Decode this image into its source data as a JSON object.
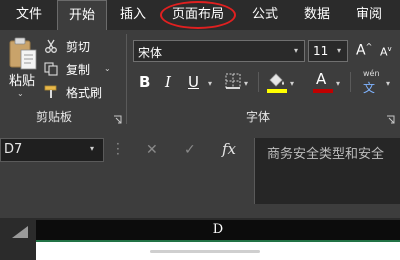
{
  "tabs": [
    {
      "label": "文件",
      "active": false
    },
    {
      "label": "开始",
      "active": true
    },
    {
      "label": "插入",
      "active": false
    },
    {
      "label": "页面布局",
      "active": false,
      "highlighted": true
    },
    {
      "label": "公式",
      "active": false
    },
    {
      "label": "数据",
      "active": false
    },
    {
      "label": "审阅",
      "active": false
    }
  ],
  "clipboard": {
    "paste_label": "粘贴",
    "cut_label": "剪切",
    "copy_label": "复制",
    "format_painter_label": "格式刷",
    "group_label": "剪贴板"
  },
  "font": {
    "font_name": "宋体",
    "font_size": "11",
    "grow_glyph": "A",
    "shrink_glyph": "A",
    "bold": "B",
    "italic": "I",
    "underline": "U",
    "font_color_glyph": "A",
    "phonetic_top": "wén",
    "phonetic_bottom": "文",
    "group_label": "字体"
  },
  "formula_bar": {
    "name_box": "D7",
    "cancel_glyph": "✕",
    "enter_glyph": "✓",
    "fx_label": "fx",
    "content": "商务安全类型和安全"
  },
  "grid": {
    "column_label": "D"
  },
  "colors": {
    "highlight_oval": "#e02020",
    "fill_color_bar": "#ffff00",
    "font_color_bar": "#c00000",
    "selected_column_border": "#217346"
  }
}
